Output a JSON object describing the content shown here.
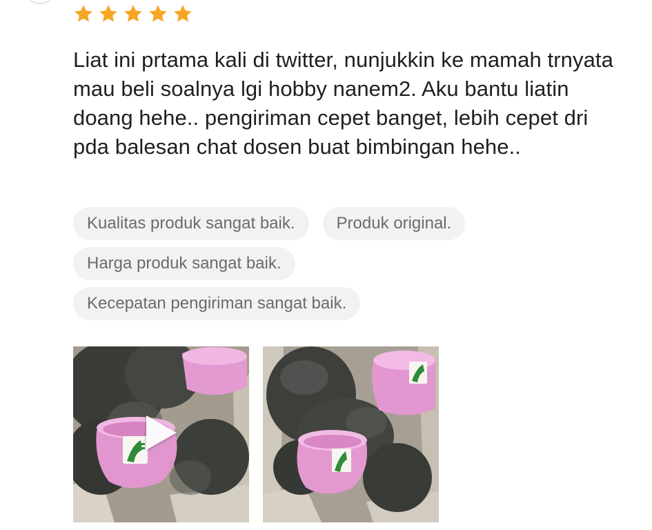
{
  "review": {
    "rating": 5,
    "rating_max": 5,
    "star_color": "#f6a623",
    "text": "Liat ini prtama kali di twitter, nunjukkin ke mamah trnyata mau beli soalnya lgi hobby nanem2. Aku bantu liatin doang hehe.. pengiriman cepet banget, lebih cepet dri pda balesan chat dosen buat bimbingan hehe..",
    "tags": [
      [
        "Kualitas produk sangat baik.",
        "Produk original."
      ],
      [
        "Harga produk sangat baik."
      ],
      [
        "Kecepatan pengiriman sangat baik."
      ]
    ],
    "media": [
      {
        "type": "video",
        "icon": "play-icon"
      },
      {
        "type": "image"
      }
    ]
  },
  "icons": {
    "star": "star-icon",
    "play": "play-icon"
  },
  "colors": {
    "text": "#1f1f1f",
    "tag_bg": "#f2f2f2",
    "tag_text": "#6b6b6b",
    "pot_pink": "#e59bd3"
  }
}
